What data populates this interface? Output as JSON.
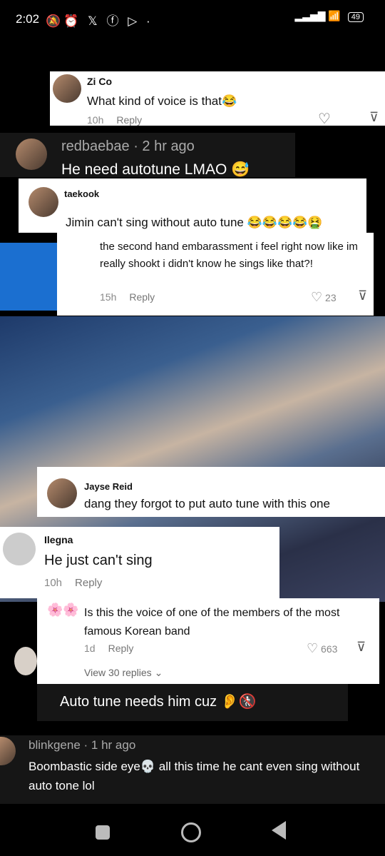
{
  "status_bar": {
    "time": "2:02",
    "battery": "49"
  },
  "comments": [
    {
      "user": "Zi Co",
      "text": "What kind of voice is that😂",
      "time": "10h",
      "reply": "Reply"
    },
    {
      "user": "redbaebae · 2 hr ago",
      "text": "He need autotune LMAO 😅"
    },
    {
      "user": "taekook",
      "text": "Jimin can't sing without auto tune 😂😂😂😂🤮"
    },
    {
      "user": "",
      "text": "the second hand embarassment i feel right now like im really shookt i didn't know he sings like that?!",
      "time": "15h",
      "reply": "Reply",
      "likes": "23"
    },
    {
      "user": "Jayse Reid",
      "text": "dang they forgot to put auto tune with this one"
    },
    {
      "user": "Ilegna",
      "text": "He just can't sing",
      "time": "10h",
      "reply": "Reply"
    },
    {
      "user": "",
      "text": "Is this the voice of one of the members of the most famous Korean band",
      "time": "1d",
      "reply": "Reply",
      "likes": "663",
      "view_replies": "View 30 replies"
    },
    {
      "user": "",
      "text": "Auto tune needs him cuz 👂🚷"
    },
    {
      "user": "blinkgene · 1 hr ago",
      "text": "Boombastic side eye💀 all this time he cant even sing without auto tone lol"
    }
  ]
}
